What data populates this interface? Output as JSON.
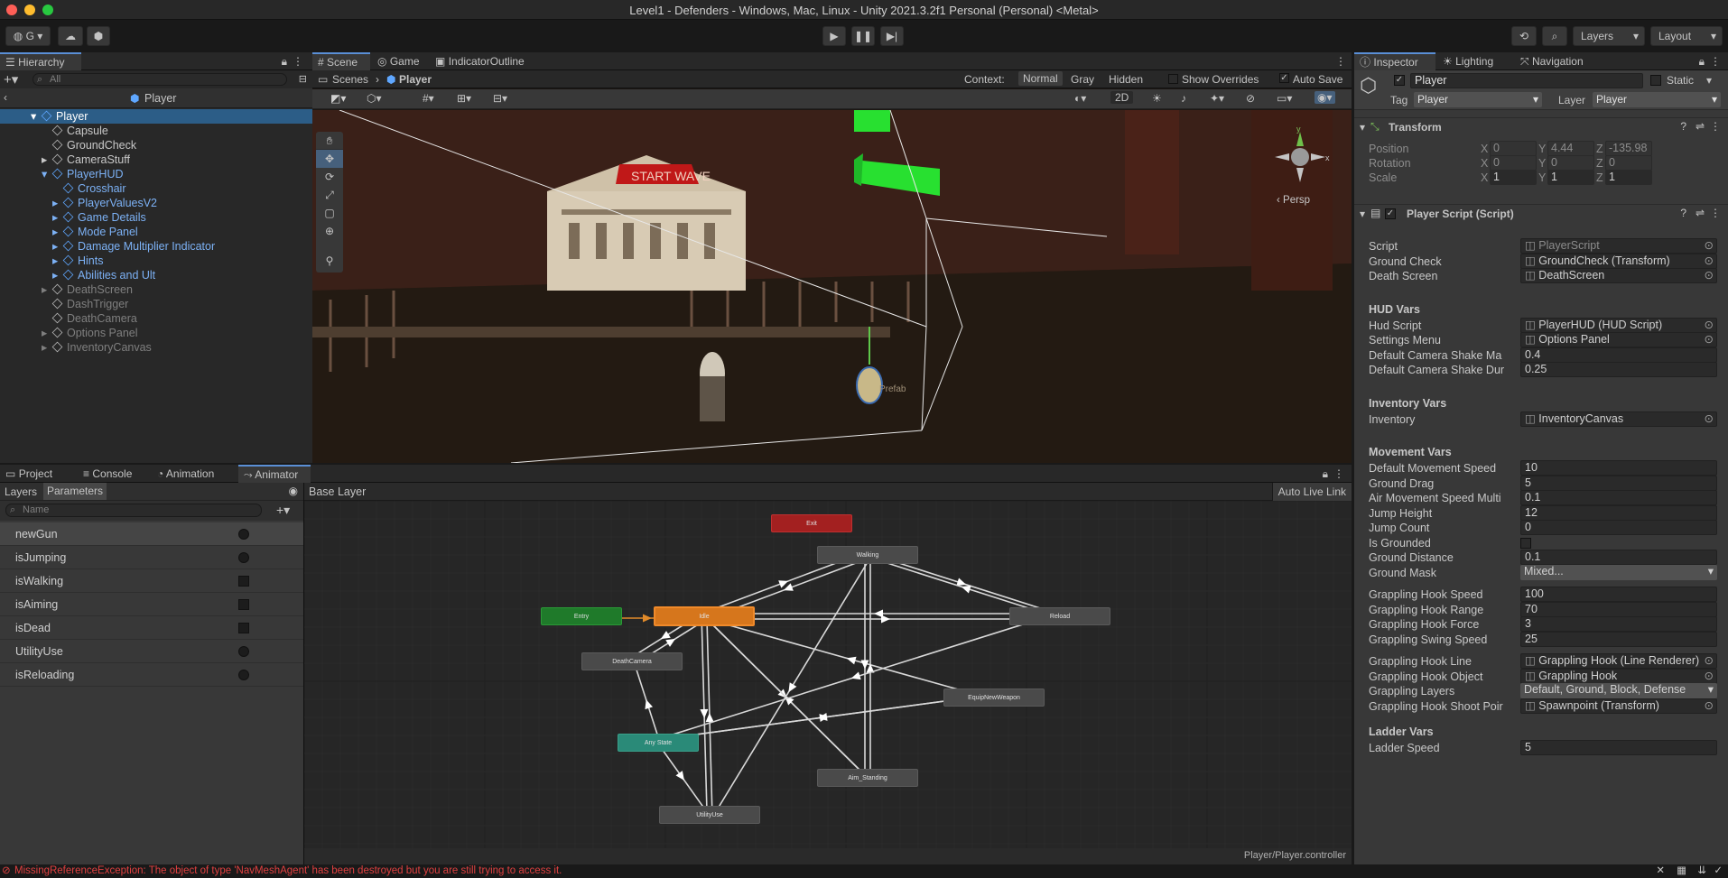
{
  "window": {
    "title": "Level1 - Defenders - Windows, Mac, Linux - Unity 2021.3.2f1 Personal (Personal) <Metal>"
  },
  "toolbar": {
    "account_label": "G",
    "layers_label": "Layers",
    "layout_label": "Layout"
  },
  "hierarchy": {
    "tab_label": "Hierarchy",
    "search_placeholder": "All",
    "breadcrumb": "Player",
    "items": [
      {
        "label": "Player",
        "indent": 0,
        "style": "selected"
      },
      {
        "label": "Capsule",
        "indent": 1,
        "style": "normal"
      },
      {
        "label": "GroundCheck",
        "indent": 1,
        "style": "normal"
      },
      {
        "label": "CameraStuff",
        "indent": 1,
        "style": "normal"
      },
      {
        "label": "PlayerHUD",
        "indent": 1,
        "style": "blue"
      },
      {
        "label": "Crosshair",
        "indent": 2,
        "style": "blue"
      },
      {
        "label": "PlayerValuesV2",
        "indent": 2,
        "style": "blue"
      },
      {
        "label": "Game Details",
        "indent": 2,
        "style": "blue"
      },
      {
        "label": "Mode Panel",
        "indent": 2,
        "style": "blue"
      },
      {
        "label": "Damage Multiplier Indicator",
        "indent": 2,
        "style": "blue"
      },
      {
        "label": "Hints",
        "indent": 2,
        "style": "blue"
      },
      {
        "label": "Abilities and Ult",
        "indent": 2,
        "style": "blue"
      },
      {
        "label": "DeathScreen",
        "indent": 1,
        "style": "grey"
      },
      {
        "label": "DashTrigger",
        "indent": 1,
        "style": "grey"
      },
      {
        "label": "DeathCamera",
        "indent": 1,
        "style": "grey"
      },
      {
        "label": "Options Panel",
        "indent": 1,
        "style": "grey"
      },
      {
        "label": "InventoryCanvas",
        "indent": 1,
        "style": "grey"
      }
    ]
  },
  "scene_tabs": {
    "scene": "Scene",
    "game": "Game",
    "indicator": "IndicatorOutline",
    "breadcrumb_root": "Scenes",
    "breadcrumb_leaf": "Player",
    "context_label": "Context:",
    "context_normal": "Normal",
    "context_gray": "Gray",
    "context_hidden": "Hidden",
    "show_overrides": "Show Overrides",
    "auto_save": "Auto Save",
    "mode_2d": "2D",
    "persp": "Persp",
    "sign_text": "START WAVE",
    "prefab_label": "Prefab"
  },
  "inspector": {
    "tabs": [
      "Inspector",
      "Lighting",
      "Navigation"
    ],
    "object_name": "Player",
    "static_label": "Static",
    "tag_label": "Tag",
    "tag_value": "Player",
    "layer_label": "Layer",
    "layer_value": "Player",
    "transform_title": "Transform",
    "position_label": "Position",
    "rotation_label": "Rotation",
    "scale_label": "Scale",
    "position": [
      "0",
      "4.44",
      "-135.98"
    ],
    "rotation": [
      "0",
      "0",
      "0"
    ],
    "scale": [
      "1",
      "1",
      "1"
    ],
    "script_title": "Player Script (Script)",
    "rows": [
      {
        "label": "Script",
        "value": "PlayerScript"
      },
      {
        "label": "Ground Check",
        "value": "GroundCheck (Transform)"
      },
      {
        "label": "Death Screen",
        "value": "DeathScreen"
      }
    ],
    "hud_header": "HUD Vars",
    "hud_rows": [
      {
        "label": "Hud Script",
        "value": "PlayerHUD (HUD Script)"
      },
      {
        "label": "Settings Menu",
        "value": "Options Panel"
      },
      {
        "label": "Default Camera Shake Ma",
        "value": "0.4"
      },
      {
        "label": "Default Camera Shake Dur",
        "value": "0.25"
      }
    ],
    "inventory_header": "Inventory Vars",
    "inventory_rows": [
      {
        "label": "Inventory",
        "value": "InventoryCanvas"
      }
    ],
    "movement_header": "Movement Vars",
    "movement_rows": [
      {
        "label": "Default Movement Speed",
        "value": "10"
      },
      {
        "label": "Ground Drag",
        "value": "5"
      },
      {
        "label": "Air Movement Speed Multi",
        "value": "0.1"
      },
      {
        "label": "Jump Height",
        "value": "12"
      },
      {
        "label": "Jump Count",
        "value": "0"
      },
      {
        "label": "Is Grounded",
        "value": ""
      },
      {
        "label": "Ground Distance",
        "value": "0.1"
      },
      {
        "label": "Ground Mask",
        "value": "Mixed..."
      }
    ],
    "grapple_rows": [
      {
        "label": "Grappling Hook Speed",
        "value": "100"
      },
      {
        "label": "Grappling Hook Range",
        "value": "70"
      },
      {
        "label": "Grappling Hook Force",
        "value": "3"
      },
      {
        "label": "Grappling Swing Speed",
        "value": "25"
      }
    ],
    "grapple_rows2": [
      {
        "label": "Grappling Hook Line",
        "value": "Grappling Hook (Line Renderer)"
      },
      {
        "label": "Grappling Hook Object",
        "value": "Grappling Hook"
      },
      {
        "label": "Grappling Layers",
        "value": "Default, Ground, Block, Defense"
      },
      {
        "label": "Grappling Hook Shoot Poir",
        "value": "Spawnpoint (Transform)"
      }
    ],
    "ladder_header": "Ladder Vars",
    "ladder_rows": [
      {
        "label": "Ladder Speed",
        "value": "5"
      }
    ]
  },
  "bottom_tabs": {
    "project": "Project",
    "console": "Console",
    "animation": "Animation",
    "animator": "Animator",
    "layers": "Layers",
    "parameters": "Parameters",
    "name_placeholder": "Name",
    "base_layer": "Base Layer",
    "auto_live_link": "Auto Live Link",
    "controller_path": "Player/Player.controller"
  },
  "parameters": [
    {
      "name": "newGun",
      "kind": "trigger"
    },
    {
      "name": "isJumping",
      "kind": "trigger"
    },
    {
      "name": "isWalking",
      "kind": "bool"
    },
    {
      "name": "isAiming",
      "kind": "bool"
    },
    {
      "name": "isDead",
      "kind": "bool"
    },
    {
      "name": "UtilityUse",
      "kind": "trigger"
    },
    {
      "name": "isReloading",
      "kind": "trigger"
    }
  ],
  "states": {
    "exit": "Exit",
    "walking": "Walking",
    "entry": "Entry",
    "idle": "Idle",
    "reload": "Reload",
    "death_camera": "DeathCamera",
    "equip": "EquipNewWeapon",
    "any_state": "Any State",
    "aim_standing": "Aim_Standing",
    "utility_use": "UtilityUse"
  },
  "status": {
    "message": "MissingReferenceException: The object of type 'NavMeshAgent' has been destroyed but you are still trying to access it."
  }
}
